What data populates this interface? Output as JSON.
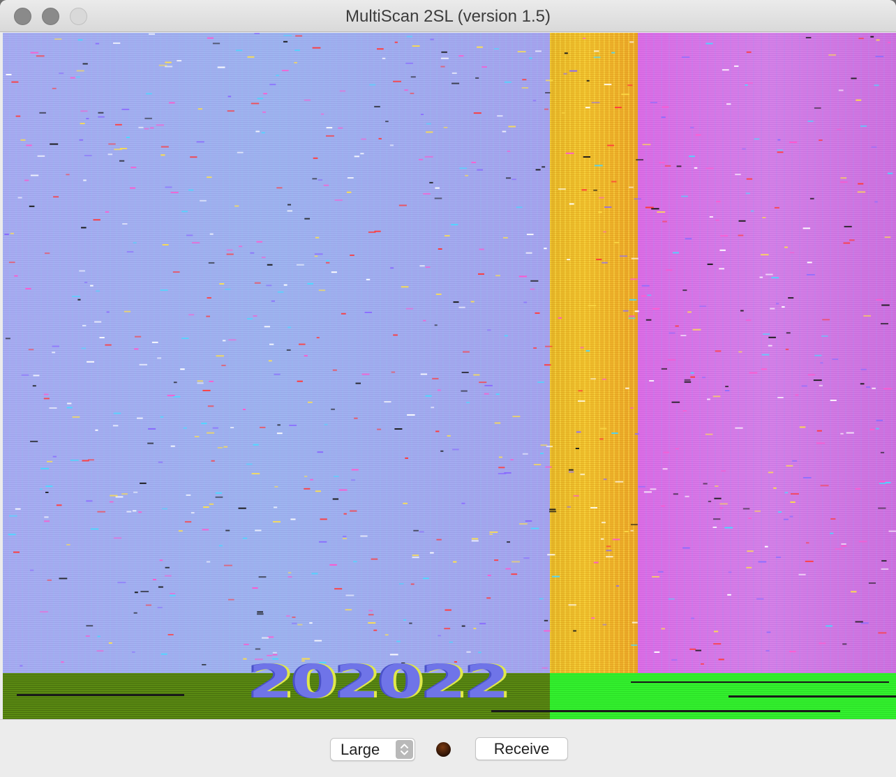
{
  "window": {
    "title": "MultiScan 2SL (version 1.5)"
  },
  "image": {
    "overlay_text": "202022",
    "colors": {
      "lavender": "#a8acf2",
      "yellow": "#f0c22e",
      "pink": "#dc6ee6",
      "dark_green": "#5a8a12",
      "bright_green": "#33f02e"
    }
  },
  "controls": {
    "size_select": {
      "value": "Large"
    },
    "status_led": {
      "color": "#2a1206"
    },
    "receive_button": {
      "label": "Receive"
    }
  },
  "icons": {
    "close": "close-icon",
    "minimize": "minimize-icon",
    "zoom": "zoom-icon",
    "stepper": "up-down-chevron-icon"
  }
}
